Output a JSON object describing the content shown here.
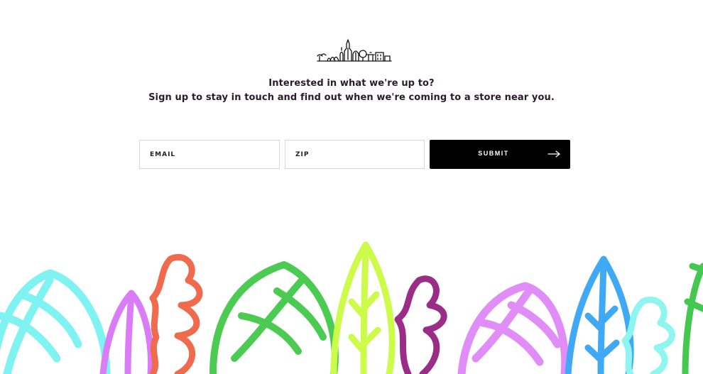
{
  "signup": {
    "headline_line1": "Interested in what we're up to?",
    "headline_line2": "Sign up to stay in touch and find out when we're coming to a store near you.",
    "email_placeholder": "EMAIL",
    "zip_placeholder": "ZIP",
    "submit_label": "SUBMIT"
  },
  "icons": {
    "logo": "city-skyline-icon",
    "submit": "arrow-right-icon"
  },
  "decoration": {
    "leaf_colors": [
      "#7ff2f2",
      "#da7cf5",
      "#f06a4d",
      "#4ccb53",
      "#cdfb4a",
      "#9a2e87",
      "#e08df7",
      "#3fa9f5",
      "#8ef5f0",
      "#45c84f"
    ]
  }
}
